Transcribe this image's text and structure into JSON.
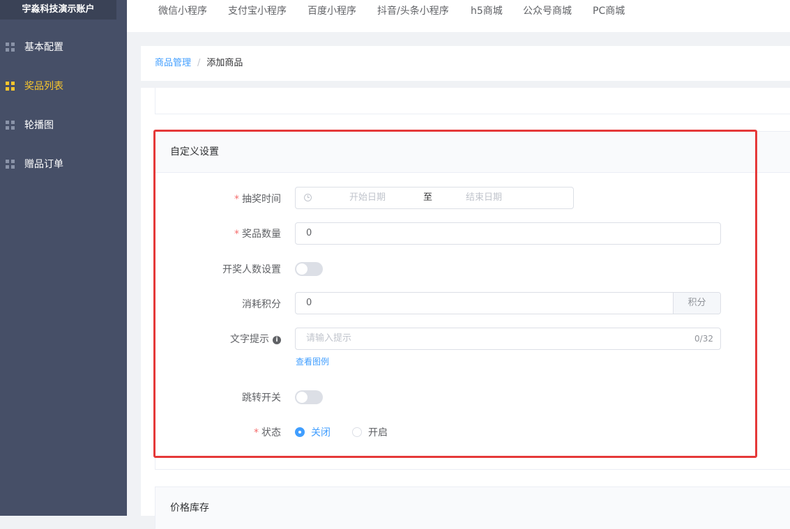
{
  "sidebar": {
    "brand": "宇淼科技演示账户",
    "items": [
      {
        "label": "基本配置",
        "icon": "grid-icon"
      },
      {
        "label": "奖品列表",
        "icon": "grid-icon",
        "active": true
      },
      {
        "label": "轮播图",
        "icon": "grid-icon"
      },
      {
        "label": "赠品订单",
        "icon": "grid-icon"
      }
    ]
  },
  "topnav": {
    "tabs": [
      "微信小程序",
      "支付宝小程序",
      "百度小程序",
      "抖音/头条小程序",
      "h5商城",
      "公众号商城",
      "PC商城"
    ]
  },
  "breadcrumb": {
    "parent": "商品管理",
    "separator": "/",
    "current": "添加商品"
  },
  "custom_section": {
    "title": "自定义设置",
    "draw_time": {
      "label": "抽奖时间",
      "required_mark": "*",
      "start_placeholder": "开始日期",
      "separator": "至",
      "end_placeholder": "结束日期"
    },
    "prize_quantity": {
      "label": "奖品数量",
      "required_mark": "*",
      "value": "0"
    },
    "participant_setting": {
      "label": "开奖人数设置",
      "enabled": false
    },
    "points_cost": {
      "label": "消耗积分",
      "value": "0",
      "unit": "积分"
    },
    "text_hint": {
      "label": "文字提示",
      "info_icon": "i",
      "placeholder": "请输入提示",
      "counter": "0/32",
      "example_link": "查看图例"
    },
    "redirect_switch": {
      "label": "跳转开关",
      "enabled": false
    },
    "status": {
      "label": "状态",
      "required_mark": "*",
      "options": [
        "关闭",
        "开启"
      ],
      "selected": "关闭"
    }
  },
  "price_section": {
    "title": "价格库存"
  },
  "colors": {
    "sidebar_bg": "#464f67",
    "brand_bg": "#3a4256",
    "active": "#f7c52d",
    "link": "#409eff",
    "required": "#f56c6c",
    "highlight_frame": "#e53939"
  }
}
